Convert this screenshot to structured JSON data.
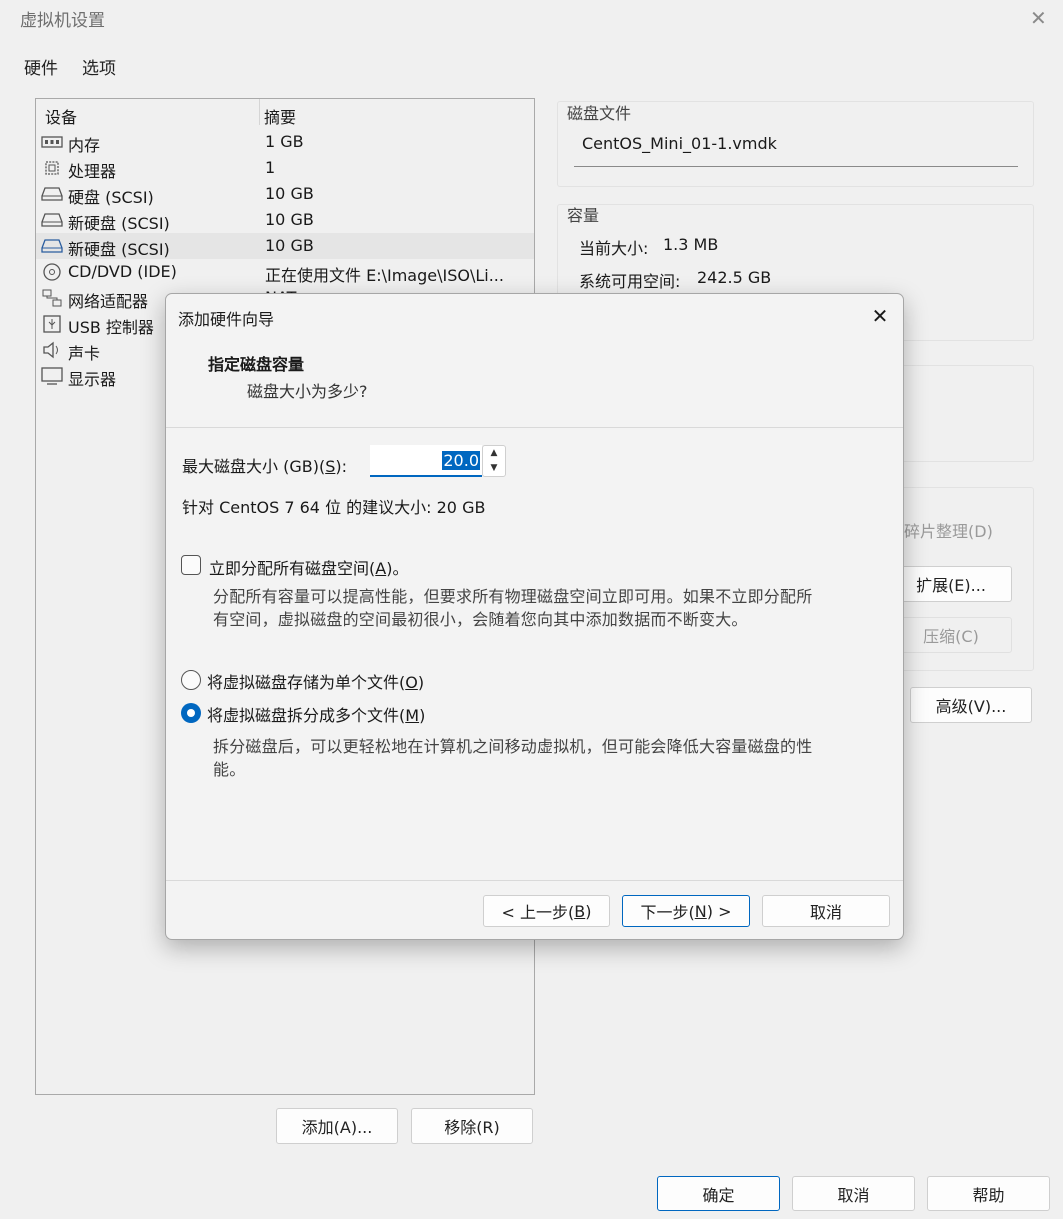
{
  "window": {
    "title": "虚拟机设置",
    "close": "✕"
  },
  "menu": [
    {
      "label": "硬件"
    },
    {
      "label": "选项"
    }
  ],
  "device_list": {
    "headers": {
      "device": "设备",
      "summary": "摘要"
    },
    "rows": [
      {
        "icon": "memory-icon",
        "name": "内存",
        "value": "1 GB"
      },
      {
        "icon": "cpu-icon",
        "name": "处理器",
        "value": "1"
      },
      {
        "icon": "hard-disk-icon",
        "name": "硬盘 (SCSI)",
        "value": "10 GB"
      },
      {
        "icon": "hard-disk-icon",
        "name": "新硬盘 (SCSI)",
        "value": "10 GB"
      },
      {
        "icon": "hard-disk-icon",
        "name": "新硬盘 (SCSI)",
        "value": "10 GB",
        "selected": true
      },
      {
        "icon": "cd-dvd-icon",
        "name": "CD/DVD (IDE)",
        "value": "正在使用文件 E:\\Image\\ISO\\Li..."
      },
      {
        "icon": "network-adapter-icon",
        "name": "网络适配器",
        "value": "NAT"
      },
      {
        "icon": "usb-icon",
        "name": "USB 控制器",
        "value": ""
      },
      {
        "icon": "sound-icon",
        "name": "声卡",
        "value": ""
      },
      {
        "icon": "display-icon",
        "name": "显示器",
        "value": ""
      }
    ]
  },
  "list_buttons": {
    "add": "添加(A)...",
    "remove": "移除(R)"
  },
  "disk_file": {
    "title": "磁盘文件",
    "value": "CentOS_Mini_01-1.vmdk"
  },
  "capacity": {
    "title": "容量",
    "current_size_label": "当前大小:",
    "current_size": "1.3 MB",
    "free_space_label": "系统可用空间:",
    "free_space": "242.5 GB"
  },
  "utilities": {
    "defrag": "碎片整理(D)",
    "expand": "扩展(E)...",
    "compact": "压缩(C)"
  },
  "advanced_button": "高级(V)...",
  "bottom_buttons": {
    "ok": "确定",
    "cancel": "取消",
    "help": "帮助"
  },
  "dialog": {
    "title": "添加硬件向导",
    "close": "✕",
    "heading": "指定磁盘容量",
    "subheading": "磁盘大小为多少?",
    "max_size_label_pre": "最大磁盘大小 (GB)(",
    "max_size_label_key": "S",
    "max_size_label_post": "):",
    "max_size_value": "20.0",
    "recommended": "针对 CentOS 7 64 位 的建议大小: 20 GB",
    "allocate_label_pre": "立即分配所有磁盘空间(",
    "allocate_label_key": "A",
    "allocate_label_post": ")。",
    "allocate_checked": false,
    "allocate_desc_1": "分配所有容量可以提高性能，但要求所有物理磁盘空间立即可用。如果不立即分配所",
    "allocate_desc_2": "有空间，虚拟磁盘的空间最初很小，会随着您向其中添加数据而不断变大。",
    "single_file_pre": "将虚拟磁盘存储为单个文件(",
    "single_file_key": "O",
    "single_file_post": ")",
    "multi_file_pre": "将虚拟磁盘拆分成多个文件(",
    "multi_file_key": "M",
    "multi_file_post": ")",
    "selected_storage": "multiple",
    "multi_desc_1": "拆分磁盘后，可以更轻松地在计算机之间移动虚拟机，但可能会降低大容量磁盘的性",
    "multi_desc_2": "能。",
    "back_pre": "< 上一步(",
    "back_key": "B",
    "back_post": ")",
    "next_pre": "下一步(",
    "next_key": "N",
    "next_post": ") >",
    "cancel": "取消"
  },
  "colors": {
    "accent": "#0067c0",
    "background": "#f0f0f0"
  }
}
